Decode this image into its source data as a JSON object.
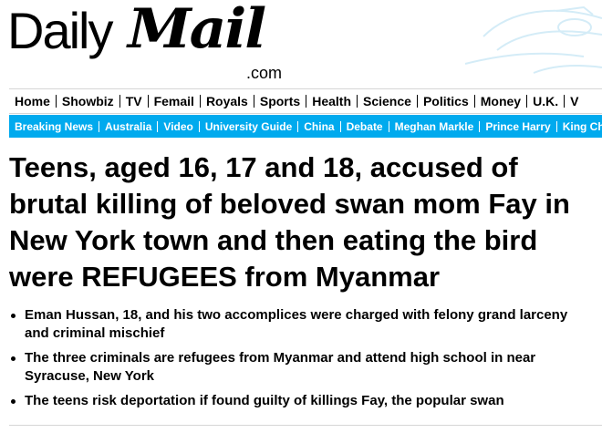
{
  "brand": {
    "daily": "Daily",
    "mail": "Mail",
    "domain": ".com",
    "accent_color": "#00aaee"
  },
  "primary_nav": {
    "items": [
      "Home",
      "Showbiz",
      "TV",
      "Femail",
      "Royals",
      "Sports",
      "Health",
      "Science",
      "Politics",
      "Money",
      "U.K.",
      "V"
    ]
  },
  "sub_nav": {
    "items": [
      "Breaking News",
      "Australia",
      "Video",
      "University Guide",
      "China",
      "Debate",
      "Meghan Markle",
      "Prince Harry",
      "King Cha"
    ]
  },
  "article": {
    "headline": "Teens, aged 16, 17 and 18, accused of brutal killing of beloved swan mom Fay in New York town and then eating the bird were REFUGEES from Myanmar",
    "bullets": [
      "Eman Hussan, 18,  and his two accomplices were charged with felony grand larceny and criminal mischief",
      "The three criminals are refugees from Myanmar and attend high school in near Syracuse, New York",
      "The teens risk deportation if found guilty of killings Fay, the popular swan"
    ]
  }
}
